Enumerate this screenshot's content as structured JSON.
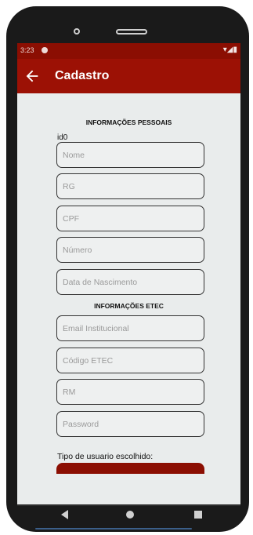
{
  "status_bar": {
    "time": "3:23",
    "indicators": "▾◢▮"
  },
  "app_bar": {
    "title": "Cadastro",
    "back_icon": "arrow-left-icon"
  },
  "sections": {
    "personal_title": "INFORMAÇÕES PESSOAIS",
    "etec_title": "INFORMAÇÕES ETEC"
  },
  "id_label": "id0",
  "fields": {
    "nome": {
      "placeholder": "Nome",
      "value": ""
    },
    "rg": {
      "placeholder": "RG",
      "value": ""
    },
    "cpf": {
      "placeholder": "CPF",
      "value": ""
    },
    "numero": {
      "placeholder": "Número",
      "value": ""
    },
    "data_nascimento": {
      "placeholder": "Data de Nascimento",
      "value": ""
    },
    "email_institucional": {
      "placeholder": "Email Institucional",
      "value": ""
    },
    "codigo_etec": {
      "placeholder": "Código ETEC",
      "value": ""
    },
    "rm": {
      "placeholder": "RM",
      "value": ""
    },
    "password": {
      "placeholder": "Password",
      "value": ""
    }
  },
  "tipo_usuario": {
    "label": "Tipo de usuario escolhido:"
  },
  "colors": {
    "primary": "#9c1105",
    "status_bar": "#8b0e02",
    "background": "#e9ecec"
  }
}
